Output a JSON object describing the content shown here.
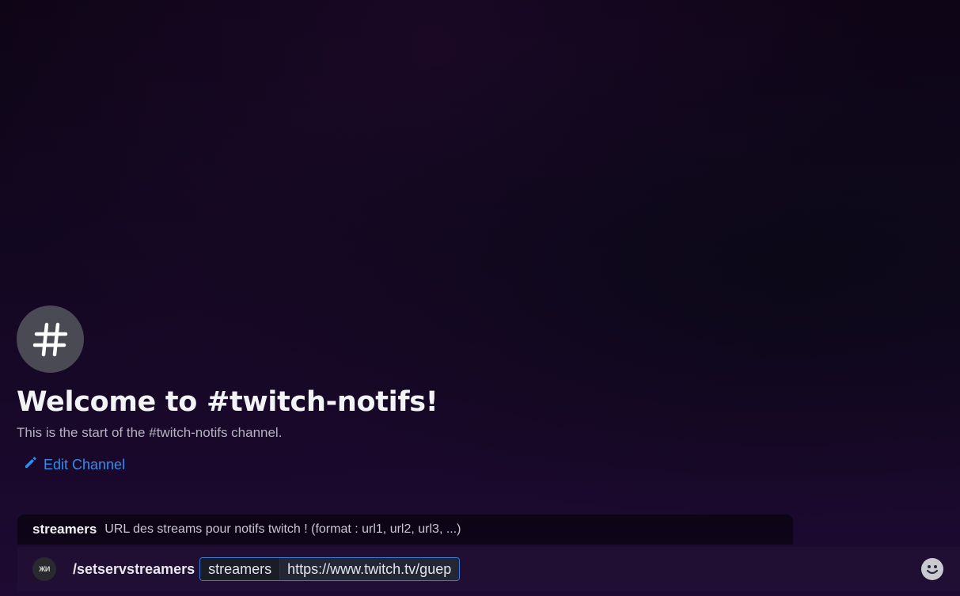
{
  "welcome": {
    "icon": "hash-icon",
    "title": "Welcome to #twitch-notifs!",
    "subtitle": "This is the start of the #twitch-notifs channel.",
    "edit_label": "Edit Channel"
  },
  "option_hint": {
    "name": "streamers",
    "description": "URL des streams pour notifs twitch ! (format : url1, url2, url3, ...)"
  },
  "composer": {
    "bot_avatar_text": "ЖИ",
    "command": "/setservstreamers",
    "option_name": "streamers",
    "option_value": "https://www.twitch.tv/guep",
    "emoji_icon": "smile-icon"
  },
  "colors": {
    "link": "#2f8ff0",
    "chip_border": "#3a7ad6",
    "avatar_bg": "#4a4a55"
  }
}
